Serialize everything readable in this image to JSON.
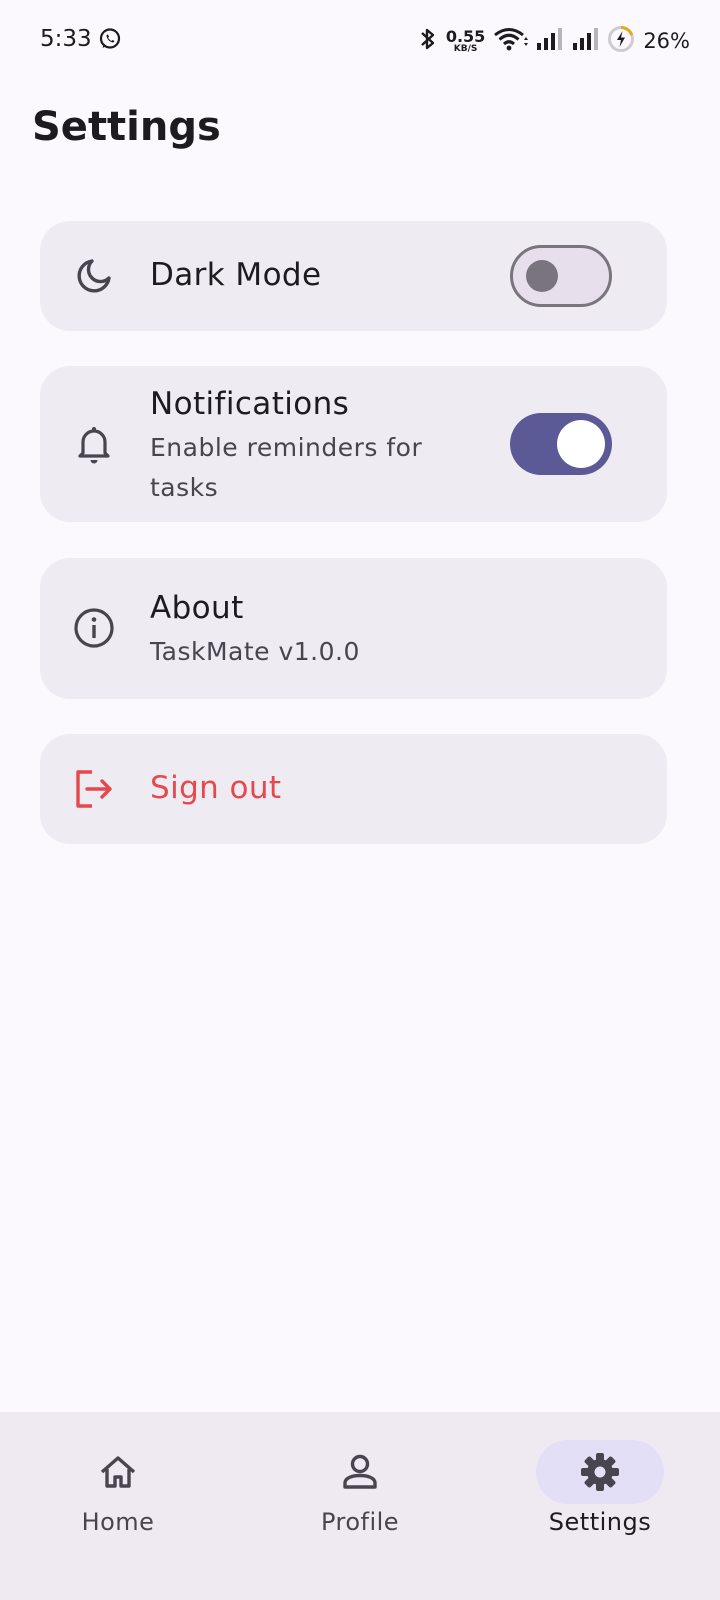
{
  "status_bar": {
    "time": "5:33",
    "speed_value": "0.55",
    "speed_unit": "KB/S",
    "battery": "26%",
    "icons": [
      "whatsapp-icon",
      "bluetooth-icon",
      "wifi-icon",
      "signal-icon",
      "signal-icon",
      "battery-charging-icon"
    ]
  },
  "header": {
    "title": "Settings"
  },
  "settings": {
    "dark_mode": {
      "label": "Dark Mode",
      "icon": "moon-icon",
      "enabled": false
    },
    "notifications": {
      "label": "Notifications",
      "description": "Enable reminders for tasks",
      "icon": "bell-icon",
      "enabled": true
    },
    "about": {
      "label": "About",
      "version": "TaskMate v1.0.0",
      "icon": "info-icon"
    },
    "sign_out": {
      "label": "Sign out",
      "icon": "logout-icon",
      "color": "#e5484d"
    }
  },
  "bottom_nav": {
    "items": [
      {
        "label": "Home",
        "icon": "home-icon",
        "active": false
      },
      {
        "label": "Profile",
        "icon": "person-icon",
        "active": false
      },
      {
        "label": "Settings",
        "icon": "gear-icon",
        "active": true
      }
    ]
  },
  "colors": {
    "background": "#fbf8fe",
    "card": "#efebf2",
    "accent": "#5b5a97",
    "danger": "#e5484d",
    "nav_indicator": "#e2dff7"
  }
}
